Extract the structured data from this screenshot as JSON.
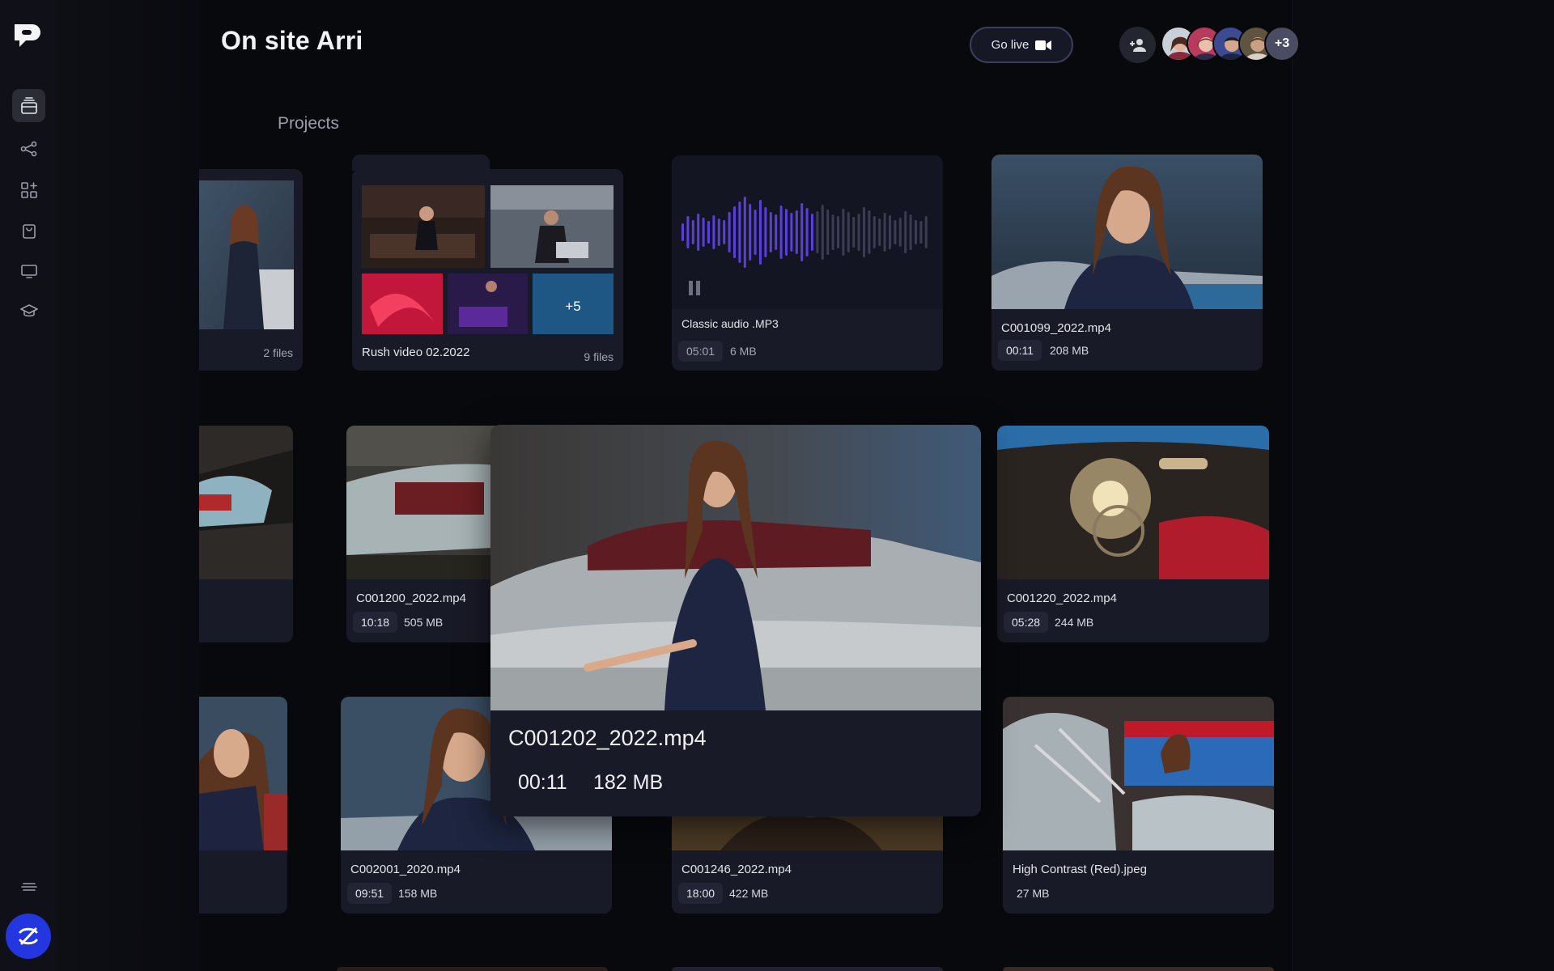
{
  "header": {
    "title": "On site Arri",
    "go_live_label": "Go live",
    "avatars_more": "+3"
  },
  "section": {
    "title": "Projects"
  },
  "sidebar": {
    "items": [
      "projects-icon",
      "share-icon",
      "apps-icon",
      "bag-icon",
      "monitor-icon",
      "graduation-icon"
    ],
    "bottom": [
      "menu-lines-icon",
      "brand-icon"
    ]
  },
  "cards": {
    "partial_folder": {
      "count": "2 files"
    },
    "folder": {
      "name": "Rush video 02.2022",
      "count": "9 files",
      "more": "+5"
    },
    "audio": {
      "name": "Classic audio .MP3",
      "duration": "05:01",
      "size": "6 MB"
    },
    "c001099": {
      "name": "C001099_2022.mp4",
      "duration": "00:11",
      "size": "208 MB"
    },
    "c001200": {
      "name": "C001200_2022.mp4",
      "duration": "10:18",
      "size": "505 MB"
    },
    "c001220": {
      "name": "C001220_2022.mp4",
      "duration": "05:28",
      "size": "244 MB"
    },
    "c002001": {
      "name": "C002001_2020.mp4",
      "duration": "09:51",
      "size": "158 MB"
    },
    "c001246": {
      "name": "C001246_2022.mp4",
      "duration": "18:00",
      "size": "422 MB"
    },
    "highcontrast": {
      "name": "High Contrast (Red).jpeg",
      "size": "27 MB"
    }
  },
  "preview": {
    "name": "C001202_2022.mp4",
    "duration": "00:11",
    "size": "182 MB"
  },
  "colors": {
    "accent": "#2336e0",
    "card": "#191a27",
    "background": "#08090d",
    "wave": "#5a3fd8"
  }
}
